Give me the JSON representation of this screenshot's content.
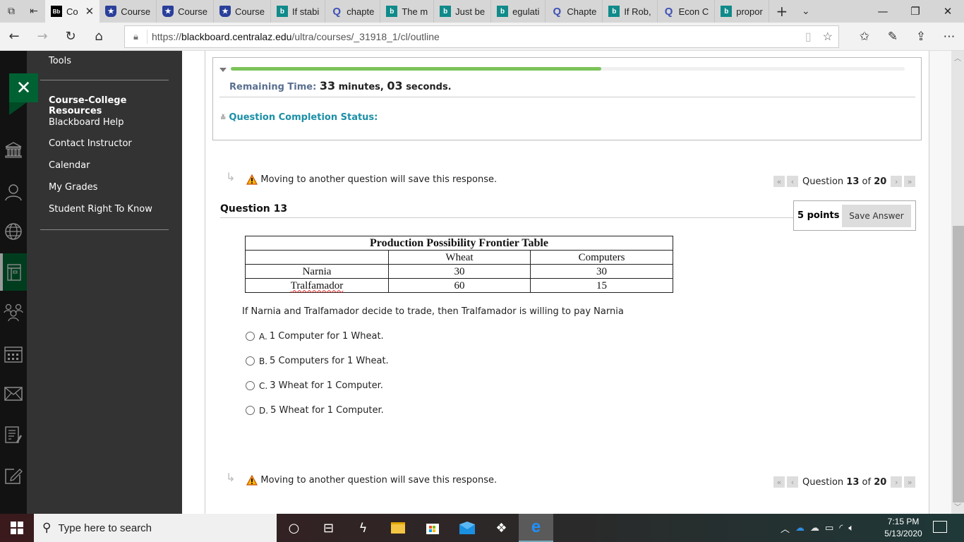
{
  "browser": {
    "tabs": [
      {
        "label": "Co",
        "favicon": "blackboard-icon",
        "active": true
      },
      {
        "label": "Course",
        "favicon": "shield-star-icon"
      },
      {
        "label": "Course",
        "favicon": "shield-star-icon"
      },
      {
        "label": "Course",
        "favicon": "shield-star-icon"
      },
      {
        "label": "If stabi",
        "favicon": "bing-icon"
      },
      {
        "label": "chapte",
        "favicon": "quizlet-icon"
      },
      {
        "label": "The m",
        "favicon": "bing-icon"
      },
      {
        "label": "Just be",
        "favicon": "bing-icon"
      },
      {
        "label": "egulati",
        "favicon": "bing-icon"
      },
      {
        "label": "Chapte",
        "favicon": "quizlet-icon"
      },
      {
        "label": "If Rob,",
        "favicon": "bing-icon"
      },
      {
        "label": "Econ C",
        "favicon": "quizlet-icon"
      },
      {
        "label": "propor",
        "favicon": "bing-icon"
      }
    ],
    "url_prefix": "https://",
    "url_domain": "blackboard.centralaz.edu",
    "url_path": "/ultra/courses/_31918_1/cl/outline"
  },
  "sidebar": {
    "tools_label": "Tools",
    "section_title": "Course-College Resources",
    "items": [
      "Blackboard Help",
      "Contact Instructor",
      "Calendar",
      "My Grades",
      "Student Right To Know"
    ]
  },
  "timer": {
    "label": "Remaining Time:",
    "minutes": "33",
    "minutes_word": "minutes,",
    "seconds": "03",
    "seconds_word": "seconds.",
    "progress_fraction": 0.55,
    "completion_status_label": "Question Completion Status:"
  },
  "warning_text": "Moving to another question will save this response.",
  "pager": {
    "prefix": "Question",
    "current": "13",
    "of": "of",
    "total": "20"
  },
  "question": {
    "title": "Question 13",
    "points": "5 points",
    "save_label": "Save Answer",
    "table": {
      "title": "Production Possibility Frontier Table",
      "headers": [
        "",
        "Wheat",
        "Computers"
      ],
      "rows": [
        [
          "Narnia",
          "30",
          "30"
        ],
        [
          "Tralfamador",
          "60",
          "15"
        ]
      ]
    },
    "prompt": "If Narnia and Tralfamador decide to trade, then Tralfamador is willing to pay Narnia",
    "options": [
      {
        "letter": "A.",
        "text": "1 Computer for 1 Wheat."
      },
      {
        "letter": "B.",
        "text": "5 Computers for 1 Wheat."
      },
      {
        "letter": "C.",
        "text": "3 Wheat for 1 Computer."
      },
      {
        "letter": "D.",
        "text": "5 Wheat for 1 Computer."
      }
    ]
  },
  "taskbar": {
    "search_placeholder": "Type here to search",
    "time": "7:15 PM",
    "date": "5/13/2020"
  }
}
